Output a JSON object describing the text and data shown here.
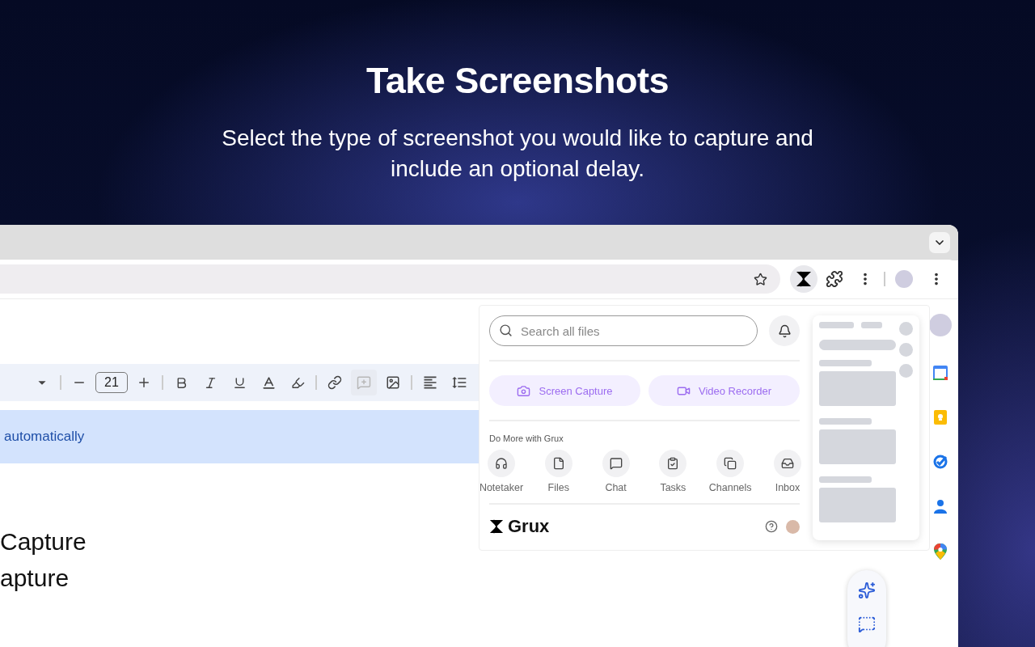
{
  "headline": "Take Screenshots",
  "subheadline": "Select the type of screenshot you would like to capture and include an optional delay.",
  "docs": {
    "toolbar": {
      "font_size": "21",
      "add_comment_disabled": true
    },
    "highlighted_text": "automatically",
    "lines": [
      "Capture",
      "apture"
    ]
  },
  "popup": {
    "search": {
      "placeholder": "Search all files"
    },
    "actions": [
      {
        "label": "Screen Capture"
      },
      {
        "label": "Video Recorder"
      }
    ],
    "section_title": "Do More with Grux",
    "apps": [
      {
        "label": "Notetaker"
      },
      {
        "label": "Files"
      },
      {
        "label": "Chat"
      },
      {
        "label": "Tasks"
      },
      {
        "label": "Channels"
      },
      {
        "label": "Inbox"
      }
    ],
    "brand": "Grux"
  }
}
